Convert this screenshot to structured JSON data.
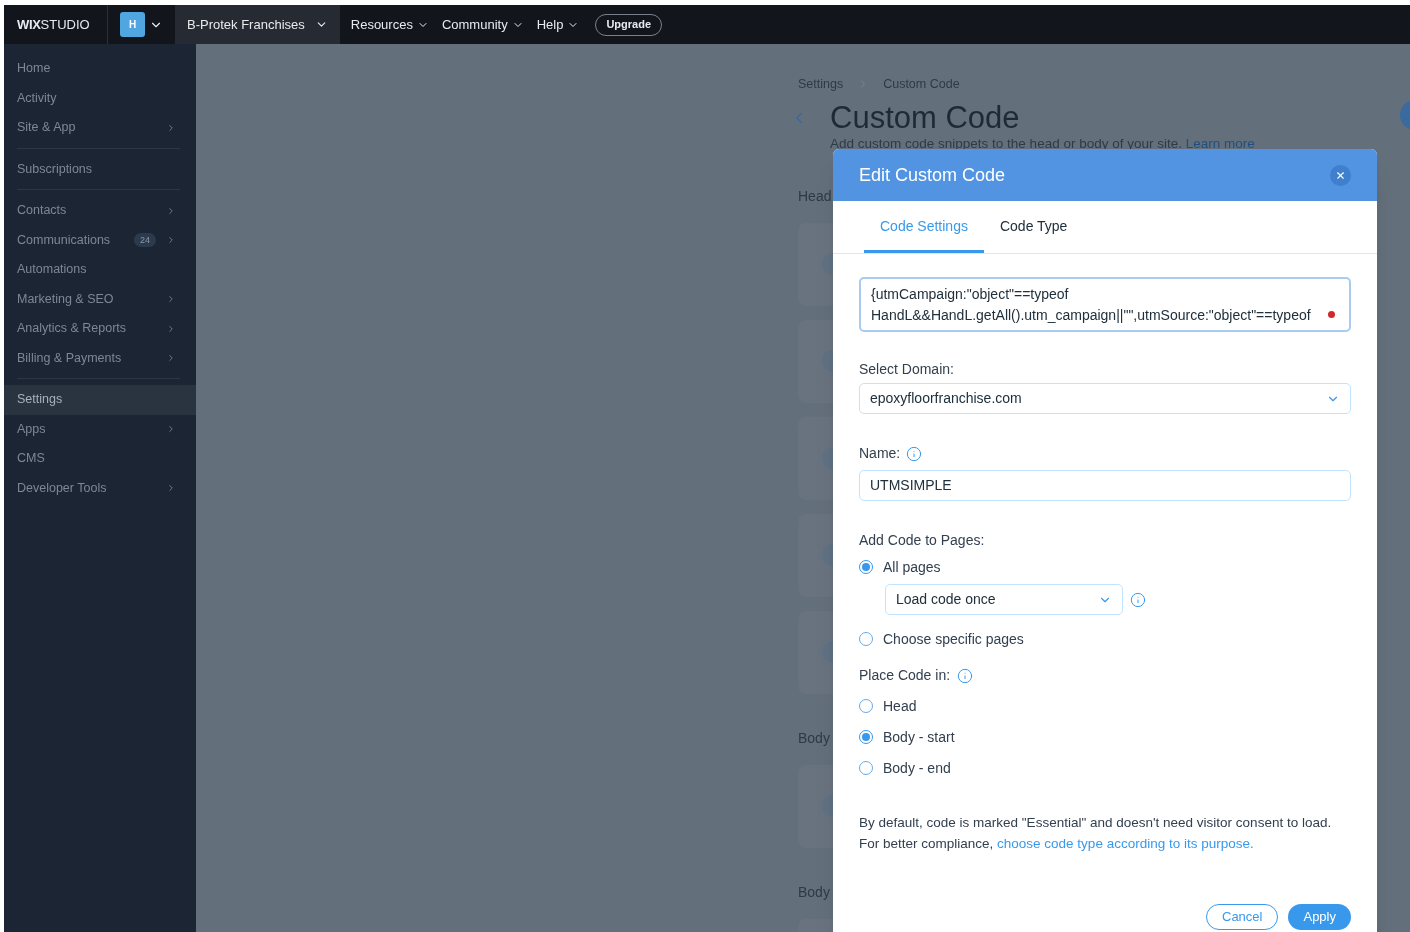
{
  "top_bar": {
    "logo_bold": "WIX",
    "logo_light": "STUDIO",
    "workspace_initial": "H",
    "site_name": "B-Protek Franchises",
    "menus": [
      "Resources",
      "Community",
      "Help"
    ],
    "upgrade": "Upgrade"
  },
  "sidebar": {
    "groups": [
      [
        {
          "label": "Home",
          "submenu": false,
          "selected": false
        },
        {
          "label": "Activity",
          "submenu": false,
          "selected": false
        },
        {
          "label": "Site & App",
          "submenu": true,
          "selected": false
        }
      ],
      [
        {
          "label": "Subscriptions",
          "submenu": false,
          "selected": false
        }
      ],
      [
        {
          "label": "Contacts",
          "submenu": true,
          "selected": false
        },
        {
          "label": "Communications",
          "submenu": true,
          "selected": false,
          "badge": "24"
        },
        {
          "label": "Automations",
          "submenu": false,
          "selected": false
        },
        {
          "label": "Marketing & SEO",
          "submenu": true,
          "selected": false
        },
        {
          "label": "Analytics & Reports",
          "submenu": true,
          "selected": false
        },
        {
          "label": "Billing & Payments",
          "submenu": true,
          "selected": false
        }
      ],
      [
        {
          "label": "Settings",
          "submenu": false,
          "selected": true
        },
        {
          "label": "Apps",
          "submenu": true,
          "selected": false
        },
        {
          "label": "CMS",
          "submenu": false,
          "selected": false
        },
        {
          "label": "Developer Tools",
          "submenu": true,
          "selected": false
        }
      ]
    ]
  },
  "page": {
    "breadcrumb": [
      "Settings",
      "Custom Code"
    ],
    "title": "Custom Code",
    "subtitle": "Add custom code snippets to the head or body of your site.",
    "learn_more": "Learn more",
    "sections": [
      {
        "label": "Head",
        "cards": [
          {
            "kind": "snippet"
          },
          {
            "kind": "snippet"
          },
          {
            "kind": "snippet"
          },
          {
            "kind": "snippet"
          },
          {
            "kind": "snippet"
          }
        ]
      },
      {
        "label": "Body",
        "cards": [
          {
            "kind": "snippet"
          }
        ]
      },
      {
        "label": "Body",
        "cards": [
          {
            "kind": "edge"
          }
        ]
      }
    ]
  },
  "modal": {
    "title": "Edit Custom Code",
    "tabs": [
      {
        "label": "Code Settings",
        "selected": true
      },
      {
        "label": "Code Type",
        "selected": false
      }
    ],
    "code_lines": [
      "{utmCampaign:\"object\"==typeof",
      "HandL&&HandL.getAll().utm_campaign||\"\",utmSource:\"object\"==typeof"
    ],
    "code_error": true,
    "domain": {
      "label": "Select Domain:",
      "value": "epoxyfloorfranchise.com"
    },
    "name": {
      "label": "Name:",
      "value": "UTMSIMPLE"
    },
    "pages": {
      "label": "Add Code to Pages:",
      "options": [
        {
          "label": "All pages",
          "selected": true,
          "load": "Load code once"
        },
        {
          "label": "Choose specific pages",
          "selected": false
        }
      ]
    },
    "place": {
      "label": "Place Code in:",
      "options": [
        {
          "label": "Head",
          "selected": false
        },
        {
          "label": "Body - start",
          "selected": true
        },
        {
          "label": "Body - end",
          "selected": false
        }
      ]
    },
    "notice": {
      "line_1": "By default, code is marked \"Essential\" and doesn't need visitor consent to load.",
      "line_2": "For better compliance, ",
      "link": "choose code type according to its purpose."
    },
    "buttons": {
      "cancel": "Cancel",
      "apply": "Apply"
    }
  }
}
